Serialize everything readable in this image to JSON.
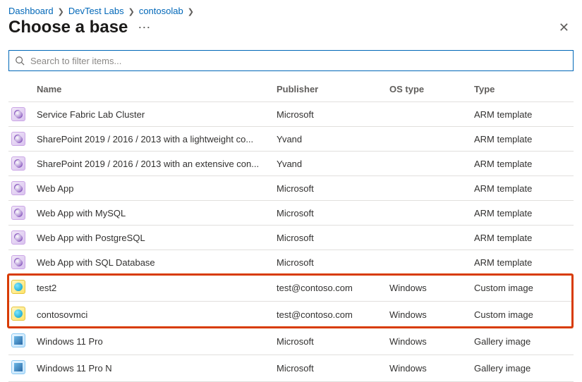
{
  "breadcrumb": [
    "Dashboard",
    "DevTest Labs",
    "contosolab"
  ],
  "title": "Choose a base",
  "search": {
    "placeholder": "Search to filter items..."
  },
  "columns": {
    "name": "Name",
    "publisher": "Publisher",
    "os": "OS type",
    "type": "Type"
  },
  "iconNames": {
    "arm": "arm-template-icon",
    "custom": "custom-image-icon",
    "gallery": "gallery-image-icon"
  },
  "highlight": {
    "from": 7,
    "to": 8
  },
  "rows": [
    {
      "icon": "arm",
      "name": "Service Fabric Lab Cluster",
      "publisher": "Microsoft",
      "os": "",
      "type": "ARM template"
    },
    {
      "icon": "arm",
      "name": "SharePoint 2019 / 2016 / 2013 with a lightweight co...",
      "publisher": "Yvand",
      "os": "",
      "type": "ARM template"
    },
    {
      "icon": "arm",
      "name": "SharePoint 2019 / 2016 / 2013 with an extensive con...",
      "publisher": "Yvand",
      "os": "",
      "type": "ARM template"
    },
    {
      "icon": "arm",
      "name": "Web App",
      "publisher": "Microsoft",
      "os": "",
      "type": "ARM template"
    },
    {
      "icon": "arm",
      "name": "Web App with MySQL",
      "publisher": "Microsoft",
      "os": "",
      "type": "ARM template"
    },
    {
      "icon": "arm",
      "name": "Web App with PostgreSQL",
      "publisher": "Microsoft",
      "os": "",
      "type": "ARM template"
    },
    {
      "icon": "arm",
      "name": "Web App with SQL Database",
      "publisher": "Microsoft",
      "os": "",
      "type": "ARM template"
    },
    {
      "icon": "custom",
      "name": "test2",
      "publisher": "test@contoso.com",
      "os": "Windows",
      "type": "Custom image"
    },
    {
      "icon": "custom",
      "name": "contosovmci",
      "publisher": "test@contoso.com",
      "os": "Windows",
      "type": "Custom image"
    },
    {
      "icon": "gallery",
      "name": "Windows 11 Pro",
      "publisher": "Microsoft",
      "os": "Windows",
      "type": "Gallery image"
    },
    {
      "icon": "gallery",
      "name": "Windows 11 Pro N",
      "publisher": "Microsoft",
      "os": "Windows",
      "type": "Gallery image"
    }
  ]
}
